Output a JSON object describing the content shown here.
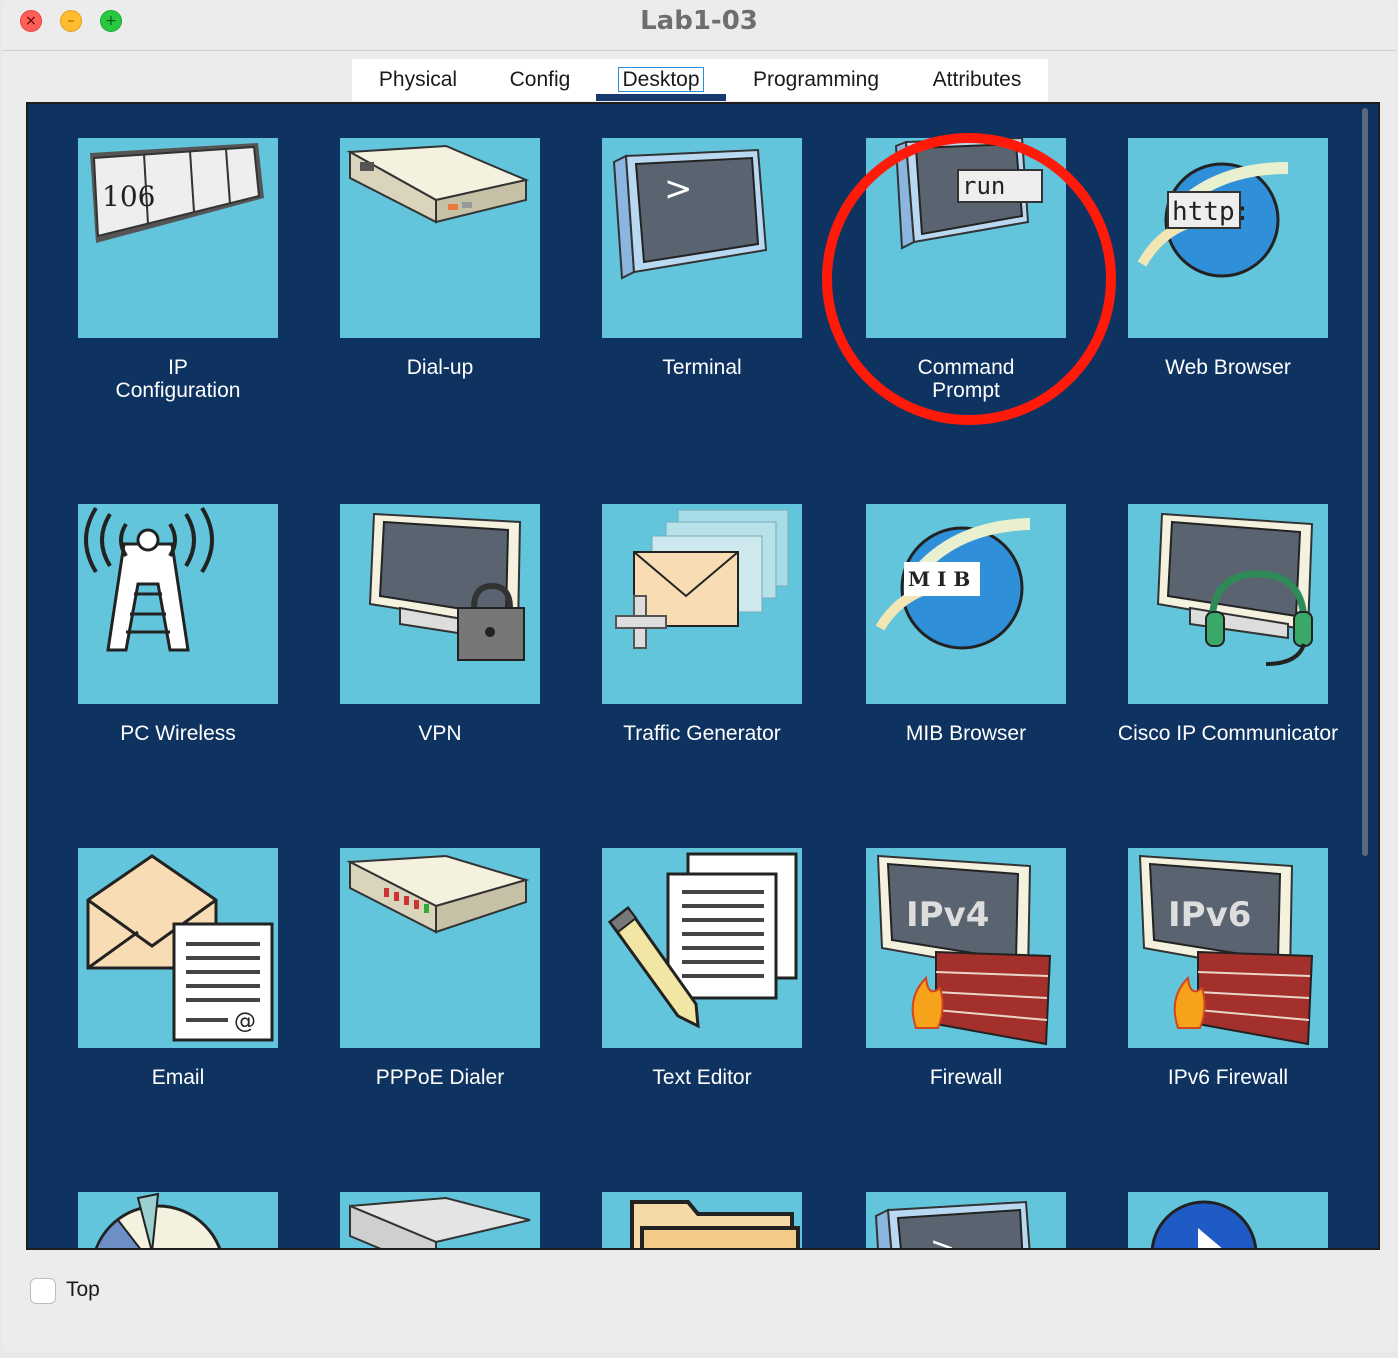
{
  "window": {
    "title": "Lab1-03",
    "controls": {
      "close": "×",
      "minimize": "–",
      "maximize": "+"
    }
  },
  "tabs": [
    {
      "label": "Physical",
      "active": false
    },
    {
      "label": "Config",
      "active": false
    },
    {
      "label": "Desktop",
      "active": true
    },
    {
      "label": "Programming",
      "active": false
    },
    {
      "label": "Attributes",
      "active": false
    }
  ],
  "apps": [
    {
      "label": "IP\nConfiguration",
      "icon": "ip-configuration-icon",
      "text": "106"
    },
    {
      "label": "Dial-up",
      "icon": "modem-icon"
    },
    {
      "label": "Terminal",
      "icon": "terminal-icon",
      "text": ">"
    },
    {
      "label": "Command\nPrompt",
      "icon": "command-prompt-icon",
      "text": "run",
      "highlighted": true
    },
    {
      "label": "Web Browser",
      "icon": "web-browser-icon",
      "text": "http:"
    },
    {
      "label": "PC Wireless",
      "icon": "wireless-tower-icon"
    },
    {
      "label": "VPN",
      "icon": "vpn-lock-icon"
    },
    {
      "label": "Traffic Generator",
      "icon": "traffic-generator-icon"
    },
    {
      "label": "MIB Browser",
      "icon": "mib-browser-icon",
      "text": "M I B"
    },
    {
      "label": "Cisco IP Communicator",
      "icon": "ip-communicator-headset-icon"
    },
    {
      "label": "Email",
      "icon": "email-icon",
      "text": "@"
    },
    {
      "label": "PPPoE Dialer",
      "icon": "pppoe-dialer-icon"
    },
    {
      "label": "Text Editor",
      "icon": "text-editor-icon"
    },
    {
      "label": "Firewall",
      "icon": "firewall-icon",
      "text": "IPv4"
    },
    {
      "label": "IPv6 Firewall",
      "icon": "ipv6-firewall-icon",
      "text": "IPv6"
    },
    {
      "label": "",
      "icon": "pie-chart-icon"
    },
    {
      "label": "",
      "icon": "device-icon"
    },
    {
      "label": "",
      "icon": "folder-icon"
    },
    {
      "label": "",
      "icon": "terminal-icon",
      "text": ">"
    },
    {
      "label": "",
      "icon": "play-icon"
    }
  ],
  "footer": {
    "top_label": "Top",
    "top_checked": false
  },
  "colors": {
    "panel": "#0f3360",
    "tile": "#62c5dc",
    "highlight_ring": "#ff1a0a",
    "active_tab": "#173a6e"
  }
}
